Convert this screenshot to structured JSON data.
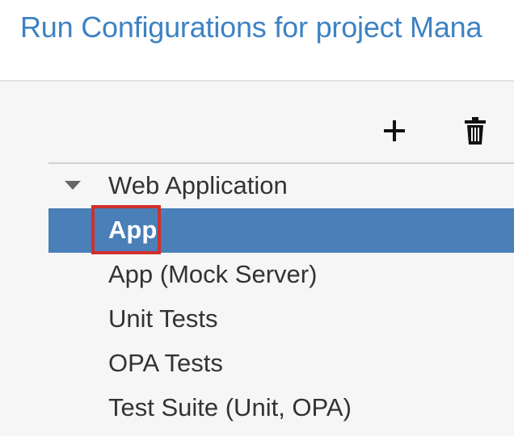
{
  "dialog": {
    "title": "Run Configurations for project Mana"
  },
  "toolbar": {
    "add_icon": "plus-icon",
    "delete_icon": "trash-icon"
  },
  "tree": {
    "group": {
      "label": "Web Application",
      "expanded": true
    },
    "items": [
      {
        "label": "App",
        "selected": true
      },
      {
        "label": "App (Mock Server)",
        "selected": false
      },
      {
        "label": "Unit Tests",
        "selected": false
      },
      {
        "label": "OPA Tests",
        "selected": false
      },
      {
        "label": "Test Suite (Unit, OPA)",
        "selected": false
      }
    ]
  },
  "colors": {
    "title": "#3d82c4",
    "selection": "#4a7fb8",
    "highlight_border": "#d0302d"
  }
}
